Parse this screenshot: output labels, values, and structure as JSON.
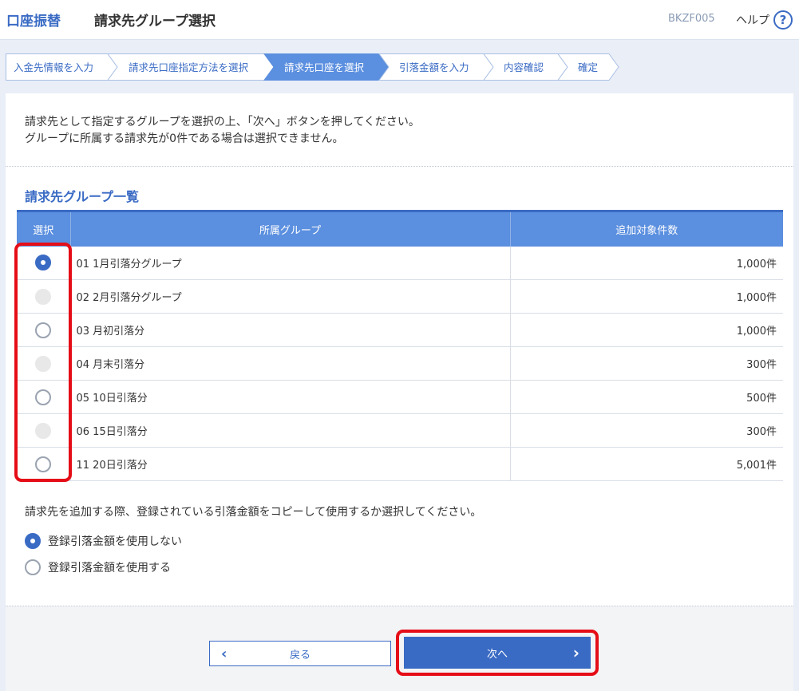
{
  "header": {
    "app_title": "口座振替",
    "page_title": "請求先グループ選択",
    "screen_id": "BKZF005",
    "help_label": "ヘルプ",
    "help_icon": "question-circle-icon"
  },
  "steps": [
    {
      "label": "入金先情報を入力",
      "active": false
    },
    {
      "label": "請求先口座指定方法を選択",
      "active": false
    },
    {
      "label": "請求先口座を選択",
      "active": true
    },
    {
      "label": "引落金額を入力",
      "active": false
    },
    {
      "label": "内容確認",
      "active": false
    },
    {
      "label": "確定",
      "active": false
    }
  ],
  "instructions": {
    "line1": "請求先として指定するグループを選択の上、「次へ」ボタンを押してください。",
    "line2": "グループに所属する請求先が0件である場合は選択できません。"
  },
  "group_list": {
    "title": "請求先グループ一覧",
    "columns": {
      "select": "選択",
      "group": "所属グループ",
      "count": "追加対象件数"
    },
    "rows": [
      {
        "group": "01 1月引落分グループ",
        "count": "1,000件",
        "state": "checked"
      },
      {
        "group": "02 2月引落分グループ",
        "count": "1,000件",
        "state": "disabled"
      },
      {
        "group": "03 月初引落分",
        "count": "1,000件",
        "state": "unchecked"
      },
      {
        "group": "04 月末引落分",
        "count": "300件",
        "state": "disabled"
      },
      {
        "group": "05 10日引落分",
        "count": "500件",
        "state": "unchecked"
      },
      {
        "group": "06 15日引落分",
        "count": "300件",
        "state": "disabled"
      },
      {
        "group": "11 20日引落分",
        "count": "5,001件",
        "state": "unchecked"
      }
    ]
  },
  "copy_option": {
    "question": "請求先を追加する際、登録されている引落金額をコピーして使用するか選択してください。",
    "options": [
      {
        "label": "登録引落金額を使用しない",
        "checked": true
      },
      {
        "label": "登録引落金額を使用する",
        "checked": false
      }
    ]
  },
  "buttons": {
    "back_label": "戻る",
    "next_label": "次へ"
  },
  "colors": {
    "brand": "#3a6bc4",
    "table_header": "#5b8fdf",
    "highlight": "#e50d17"
  }
}
